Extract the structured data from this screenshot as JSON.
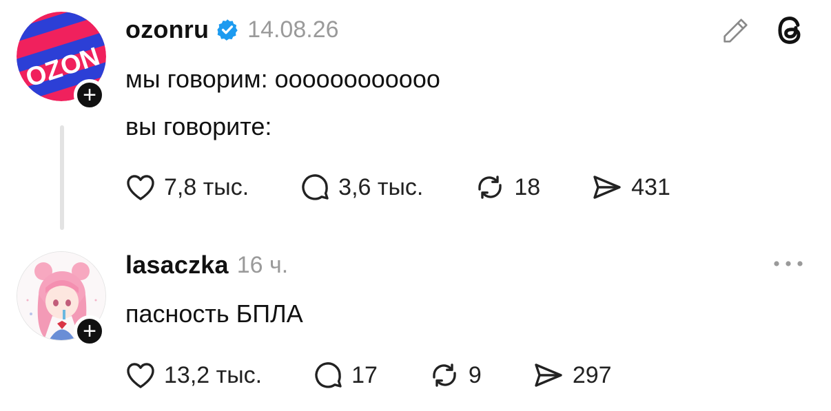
{
  "posts": [
    {
      "username": "ozonru",
      "verified": true,
      "time": "14.08.26",
      "avatar_text": "OZON",
      "lines": [
        "мы говорим: оооооооооооо",
        "вы говорите:"
      ],
      "likes": "7,8 тыс.",
      "replies": "3,6 тыс.",
      "reposts": "18",
      "shares": "431",
      "header_icons": [
        "pencil-icon",
        "threads-logo-icon"
      ]
    },
    {
      "username": "lasaczka",
      "verified": false,
      "time": "16 ч.",
      "avatar": "anime-girl-avatar",
      "lines": [
        "пасность БПЛА"
      ],
      "likes": "13,2 тыс.",
      "replies": "17",
      "reposts": "9",
      "shares": "297",
      "header_icons": [
        "more-options-icon"
      ]
    }
  ],
  "follow_symbol": "+",
  "colors": {
    "verified": "#1d9bf0",
    "ozon_pink": "#f0215d",
    "ozon_blue": "#2c3fd6",
    "muted": "#9a9a9a"
  }
}
